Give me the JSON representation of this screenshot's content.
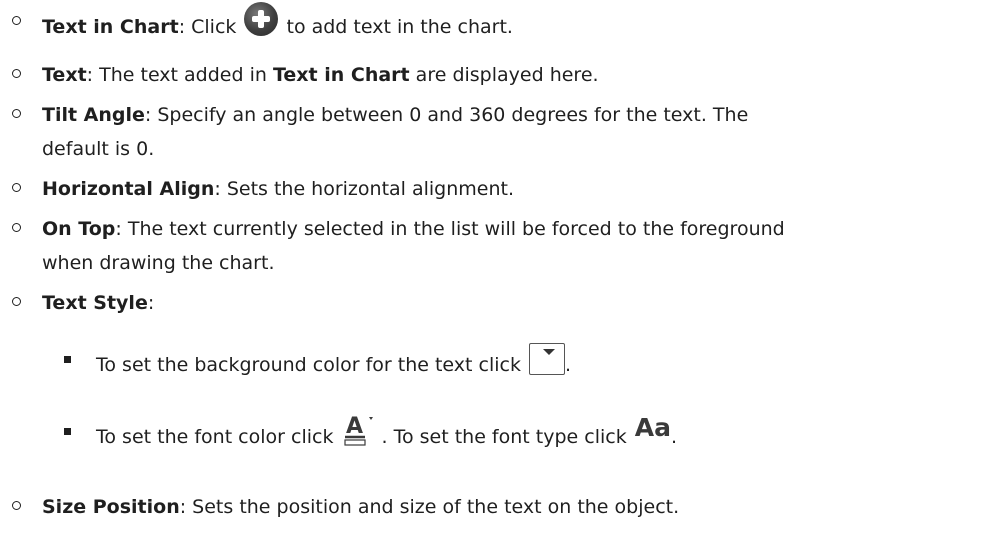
{
  "items": {
    "text_in_chart": {
      "term": "Text in Chart",
      "before": ": Click ",
      "after": " to add text in the chart."
    },
    "text": {
      "term": "Text",
      "before": ": The text added in ",
      "ref": "Text in Chart",
      "after": " are displayed here."
    },
    "tilt_angle": {
      "term": "Tilt Angle",
      "line1": ": Specify an angle between 0 and 360 degrees for the text. The",
      "line2": "default is 0."
    },
    "horizontal_align": {
      "term": "Horizontal Align",
      "desc": ": Sets the horizontal alignment."
    },
    "on_top": {
      "term": "On Top",
      "line1": ": The text currently selected in the list will be forced to the foreground",
      "line2": "when drawing the chart."
    },
    "text_style": {
      "term": "Text Style",
      "colon": ":",
      "sub1": {
        "before": "To set the background color for the text click ",
        "after": "."
      },
      "sub2": {
        "before": "To set the font color click ",
        "middle": ". To set the font type click ",
        "after": "."
      }
    },
    "size_position": {
      "term": "Size Position",
      "desc": ": Sets the position and size of the text on the object."
    }
  },
  "icons": {
    "add": "plus-circle-icon",
    "background_color": "dropdown-box-icon",
    "font_color": "font-color-icon",
    "font_type": "font-type-icon",
    "font_type_glyph": "Aa",
    "font_color_glyph": "A"
  },
  "colors": {
    "text": "#1f1f1f",
    "icon_gray": "#3f3f3f"
  }
}
